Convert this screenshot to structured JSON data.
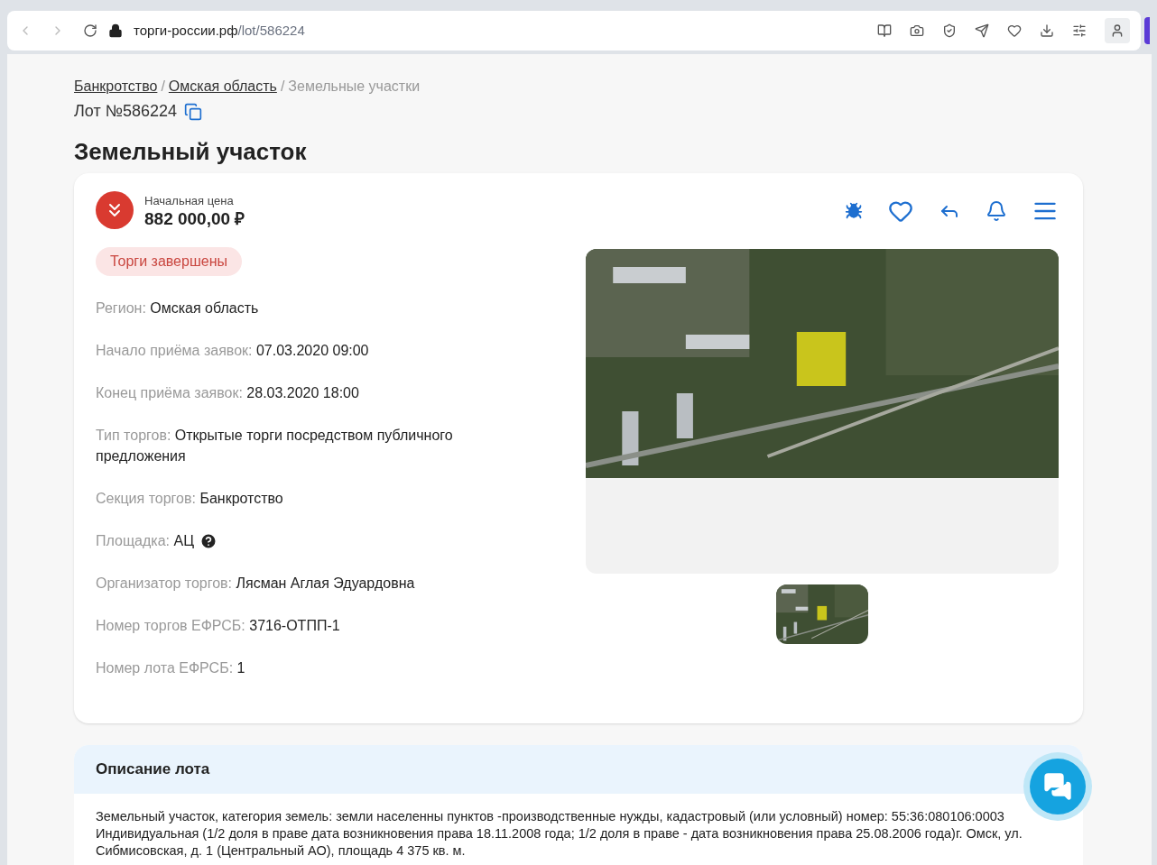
{
  "browser": {
    "url_host": "торги-россии.рф",
    "url_path": "/lot/586224"
  },
  "breadcrumb_separator": "/",
  "breadcrumbs": [
    {
      "label": "Банкротство",
      "link": true
    },
    {
      "label": "Омская область",
      "link": true
    },
    {
      "label": "Земельные участки",
      "link": false
    }
  ],
  "lot_number": "Лот №586224",
  "title": "Земельный участок",
  "price": {
    "label": "Начальная цена",
    "value": "882 000,00 ₽"
  },
  "status": "Торги завершены",
  "fields": [
    {
      "label": "Регион:",
      "value": "Омская область",
      "kind": "plain"
    },
    {
      "label": "Начало приёма заявок:",
      "value": "07.03.2020 09:00",
      "kind": "plain"
    },
    {
      "label": "Конец приёма заявок:",
      "value": "28.03.2020 18:00",
      "kind": "plain"
    },
    {
      "label": "Тип торгов:",
      "value": "Открытые торги посредством публичного предложения",
      "kind": "plain"
    },
    {
      "label": "Секция торгов:",
      "value": "Банкротство",
      "kind": "plain"
    },
    {
      "label": "Площадка:",
      "value": "АЦ",
      "kind": "help"
    },
    {
      "label": "Организатор торгов:",
      "value": "Лясман Аглая Эдуардовна",
      "kind": "plain"
    },
    {
      "label": "Номер торгов ЕФРСБ:",
      "value": "3716-ОТПП-1",
      "kind": "plain"
    },
    {
      "label": "Номер лота ЕФРСБ:",
      "value": "1",
      "kind": "plain"
    }
  ],
  "description": {
    "title": "Описание лота",
    "text": "Земельный участок, категория земель: земли населенны пунктов -производственные нужды, кадастровый (или условный) номер: 55:36:080106:0003 Индивидуальная (1/2 доля в праве дата возникновения права 18.11.2008 года; 1/2 доля в праве - дата возникновения права 25.08.2006 года)г. Омск, ул. Сибмисовская, д. 1 (Центральный АО), площадь 4 375 кв. м."
  }
}
